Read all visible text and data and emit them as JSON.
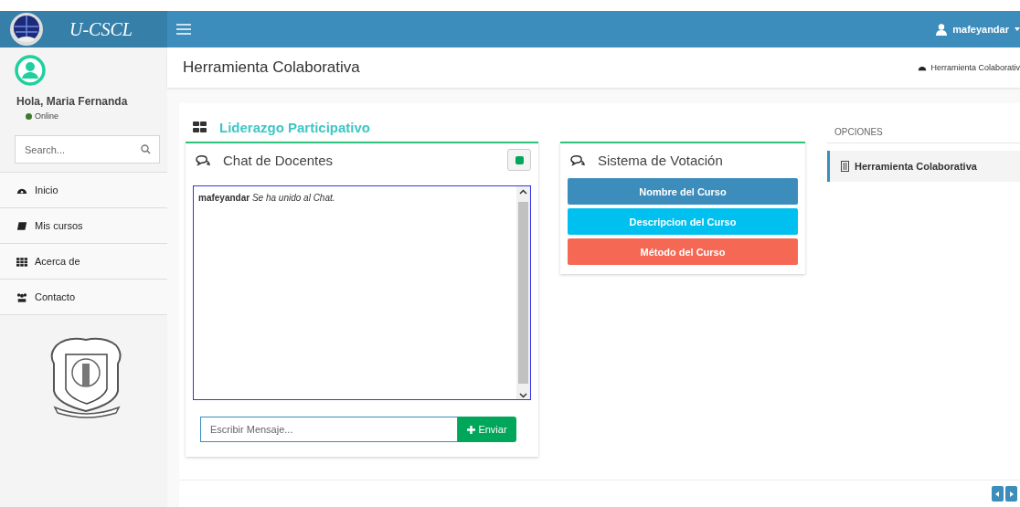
{
  "header": {
    "brand": "U-CSCL",
    "user": "mafeyandar"
  },
  "sidebar": {
    "greeting": "Hola, Maria Fernanda",
    "status": "Online",
    "search": {
      "placeholder": "Search..."
    },
    "items": [
      {
        "label": "Inicio",
        "kind": "dashboard"
      },
      {
        "label": "Mis cursos",
        "kind": "book"
      },
      {
        "label": "Acerca de",
        "kind": "grid"
      },
      {
        "label": "Contacto",
        "kind": "users"
      }
    ]
  },
  "page": {
    "title": "Herramienta Colaborativa",
    "breadcrumb": "Herramienta Colaborativ"
  },
  "section": {
    "title": "Liderazgo Participativo"
  },
  "chat": {
    "title": "Chat de Docentes",
    "messages": [
      "**mafeyandar** *Se ha unido al Chat.*"
    ],
    "input": {
      "placeholder": "Escribir Mensaje..."
    },
    "send": "Enviar"
  },
  "voting": {
    "title": "Sistema de Votación",
    "buttons": [
      {
        "label": "Nombre del Curso",
        "color": "#3c8dbc"
      },
      {
        "label": "Descripcion del Curso",
        "color": "#00c0ef"
      },
      {
        "label": "Método del Curso",
        "color": "#f56954"
      }
    ]
  },
  "options": {
    "heading": "OPCIONES",
    "items": [
      {
        "label": "Herramienta Colaborativa",
        "selected": true
      }
    ]
  }
}
